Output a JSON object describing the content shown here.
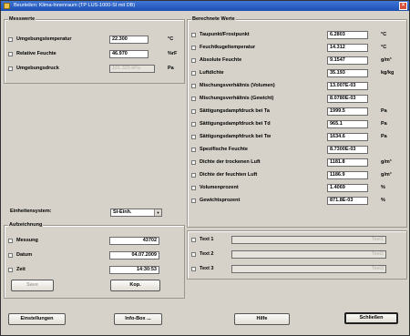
{
  "window": {
    "title": "Beurteilen: Klima-Innenraum (TP LUS-1000-SI mit DB)"
  },
  "measurement": {
    "title": "Messwerte",
    "rows": [
      {
        "label": "Umgebungstemperatur",
        "value": "22.300",
        "unit": "°C",
        "checked": true
      },
      {
        "label": "Relative Feuchte",
        "value": "46.970",
        "unit": "%rF",
        "checked": true
      },
      {
        "label": "Umgebungsdruck",
        "value": "101.325 kPa",
        "unit": "Pa",
        "checked": false
      }
    ]
  },
  "calculated": {
    "title": "Berechnete Werte",
    "rows": [
      {
        "label": "Taupunkt/Frostpunkt",
        "value": "6.2803",
        "unit": "°C"
      },
      {
        "label": "Feuchtkugeltemperatur",
        "value": "14.312",
        "unit": "°C"
      },
      {
        "label": "Absolute Feuchte",
        "value": "9.1547",
        "unit": "g/m³"
      },
      {
        "label": "Luftdichte",
        "value": "35.193",
        "unit": "kg/kg"
      },
      {
        "label": "Mischungsverhältnis (Volumen)",
        "value": "13.007E-03",
        "unit": ""
      },
      {
        "label": "Mischungsverhältnis (Gewicht)",
        "value": "8.0780E-03",
        "unit": ""
      },
      {
        "label": "Sättigungsdampfdruck bei Ta",
        "value": "1999.5",
        "unit": "Pa"
      },
      {
        "label": "Sättigungsdampfdruck bei Td",
        "value": "965.1",
        "unit": "Pa"
      },
      {
        "label": "Sättigungsdampfdruck bei Tw",
        "value": "1634.6",
        "unit": "Pa"
      },
      {
        "label": "Spezifische Feuchte",
        "value": "8.7300E-03",
        "unit": ""
      },
      {
        "label": "Dichte der trockenen Luft",
        "value": "1181.8",
        "unit": "g/m³"
      },
      {
        "label": "Dichte der feuchten Luft",
        "value": "1186.9",
        "unit": "g/m³"
      },
      {
        "label": "Volumenprozent",
        "value": "1.4069",
        "unit": "%"
      },
      {
        "label": "Gewichtsprozent",
        "value": "871.8E-03",
        "unit": "%"
      }
    ]
  },
  "units": {
    "label": "Einheitensystem:",
    "selected": "SI-Einh."
  },
  "recording": {
    "title": "Aufzeichnung",
    "rows": [
      {
        "label": "Messung",
        "value": "43702"
      },
      {
        "label": "Datum",
        "value": "04.07.2009"
      },
      {
        "label": "Zeit",
        "value": "14:30:53"
      }
    ],
    "save_label": "Save",
    "copy_label": "Kop."
  },
  "texts": [
    {
      "label": "Text 1",
      "value": "Text1"
    },
    {
      "label": "Text 2",
      "value": "Text2"
    },
    {
      "label": "Text 3",
      "value": "Text3"
    }
  ],
  "footer": {
    "settings_label": "Einstellungen",
    "info_label": "Info-Box ...",
    "help_label": "Hilfe",
    "close_label": "Schließen"
  }
}
